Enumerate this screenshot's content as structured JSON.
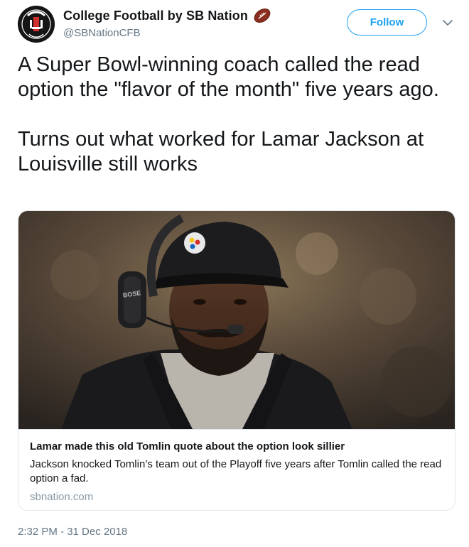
{
  "author": {
    "display_name": "College Football by SB Nation",
    "handle": "@SBNationCFB",
    "avatar_label": "SBNATION",
    "name_emoji": "american-football-emoji"
  },
  "header": {
    "follow_label": "Follow",
    "menu_icon": "chevron-down-icon"
  },
  "tweet": {
    "paragraphs": [
      "A Super Bowl-winning coach called the read option the \"flavor of the month\" five years ago.",
      "Turns out what worked for Lamar Jackson at Louisville still works"
    ],
    "timestamp": "2:32 PM - 31 Dec 2018"
  },
  "card": {
    "image_alt": "Coach wearing a headset and black cap on the sideline",
    "headset_brand": "BOSE",
    "title": "Lamar made this old Tomlin quote about the option look sillier",
    "description": "Jackson knocked Tomlin’s team out of the Playoff five years after Tomlin called the read option a fad.",
    "domain": "sbnation.com"
  },
  "colors": {
    "accent": "#1da1f2",
    "secondary_text": "#657786",
    "border": "#e1e8ed"
  }
}
